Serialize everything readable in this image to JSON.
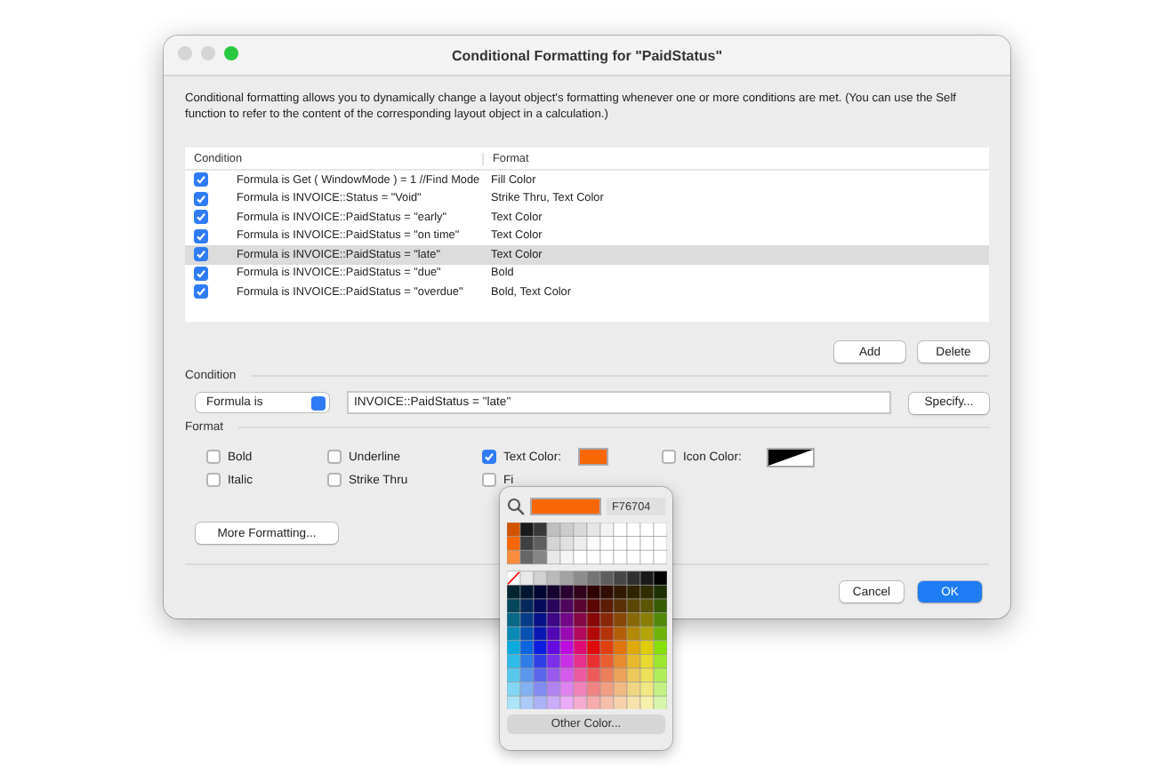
{
  "window": {
    "title": "Conditional Formatting for \"PaidStatus\""
  },
  "description": "Conditional formatting allows you to dynamically change a layout object's formatting whenever one or more conditions are met.  (You can use the Self function to refer to the content of the corresponding layout object in a calculation.)",
  "table": {
    "columns": [
      "Condition",
      "Format"
    ],
    "rows": [
      {
        "checked": true,
        "selected": false,
        "condition": "Formula is Get ( WindowMode ) = 1 //Find Mode",
        "format": "Fill Color"
      },
      {
        "checked": true,
        "selected": false,
        "condition": "Formula is INVOICE::Status = \"Void\"",
        "format": "Strike Thru, Text Color"
      },
      {
        "checked": true,
        "selected": false,
        "condition": "Formula is INVOICE::PaidStatus = \"early\"",
        "format": "Text Color"
      },
      {
        "checked": true,
        "selected": false,
        "condition": "Formula is INVOICE::PaidStatus = \"on time\"",
        "format": "Text Color"
      },
      {
        "checked": true,
        "selected": true,
        "condition": "Formula is INVOICE::PaidStatus = \"late\"",
        "format": "Text Color"
      },
      {
        "checked": true,
        "selected": false,
        "condition": "Formula is INVOICE::PaidStatus = \"due\"",
        "format": "Bold"
      },
      {
        "checked": true,
        "selected": false,
        "condition": "Formula is INVOICE::PaidStatus = \"overdue\"",
        "format": "Bold, Text Color"
      }
    ]
  },
  "table_buttons": [
    "Add",
    "Delete"
  ],
  "condition": {
    "heading": "Condition",
    "type": "Formula is",
    "formula": "INVOICE::PaidStatus = \"late\"",
    "specify": "Specify..."
  },
  "format": {
    "heading": "Format",
    "options": [
      {
        "label": "Bold",
        "checked": false
      },
      {
        "label": "Underline",
        "checked": false
      },
      {
        "label": "Text Color:",
        "checked": true,
        "color": "#f76704"
      },
      {
        "label": "Icon Color:",
        "checked": false
      },
      {
        "label": "Italic",
        "checked": false
      },
      {
        "label": "Strike Thru",
        "checked": false
      },
      {
        "label": "Fi",
        "checked": false
      }
    ],
    "more": "More Formatting..."
  },
  "color_popover": {
    "hex": "F76704",
    "other": "Other Color..."
  },
  "buttons": [
    "Cancel",
    "OK"
  ]
}
